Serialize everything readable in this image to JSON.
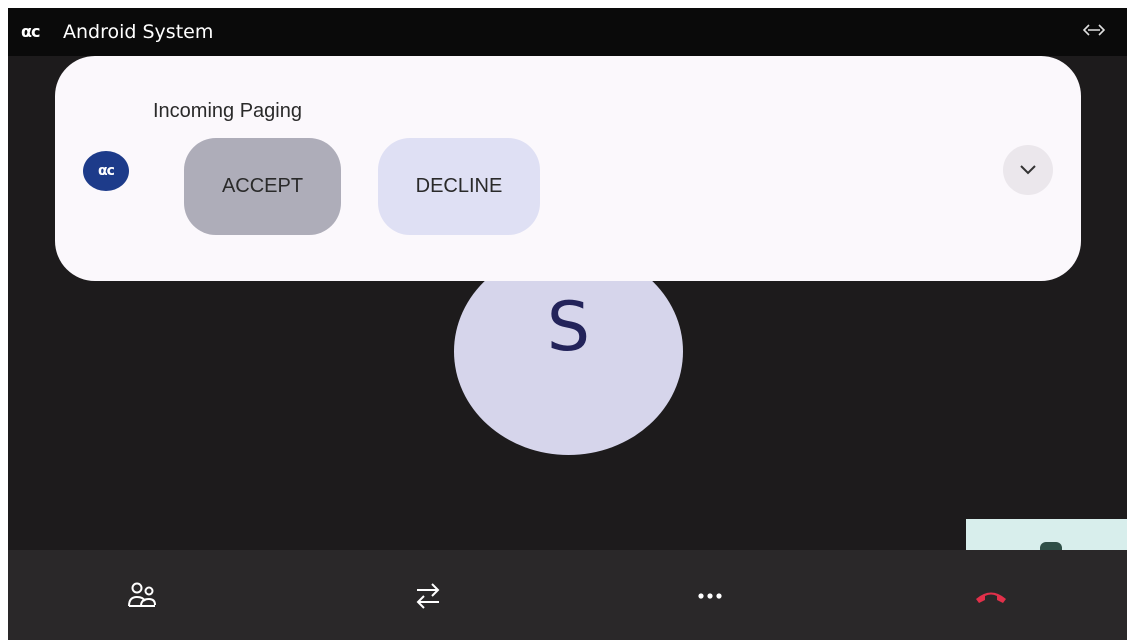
{
  "status_bar": {
    "app_logo_text": "αc",
    "title": "Android System",
    "right_icon": "resize-horizontal-icon"
  },
  "call": {
    "avatar_initial": "S"
  },
  "notification": {
    "app_icon_text": "αc",
    "title": "Incoming Paging",
    "accept_label": "ACCEPT",
    "decline_label": "DECLINE",
    "expand_icon": "chevron-down-icon"
  },
  "toolbar": {
    "items": [
      {
        "icon": "contacts-icon"
      },
      {
        "icon": "transfer-icon"
      },
      {
        "icon": "more-icon"
      },
      {
        "icon": "hang-up-icon"
      }
    ]
  },
  "colors": {
    "background": "#1d1b1c",
    "card": "#fbf8fc",
    "accept_button": "#aeadb9",
    "decline_button": "#dfe0f4",
    "avatar": "#d6d5eb",
    "hang_up": "#e2304a",
    "app_icon": "#1d3b8a"
  }
}
